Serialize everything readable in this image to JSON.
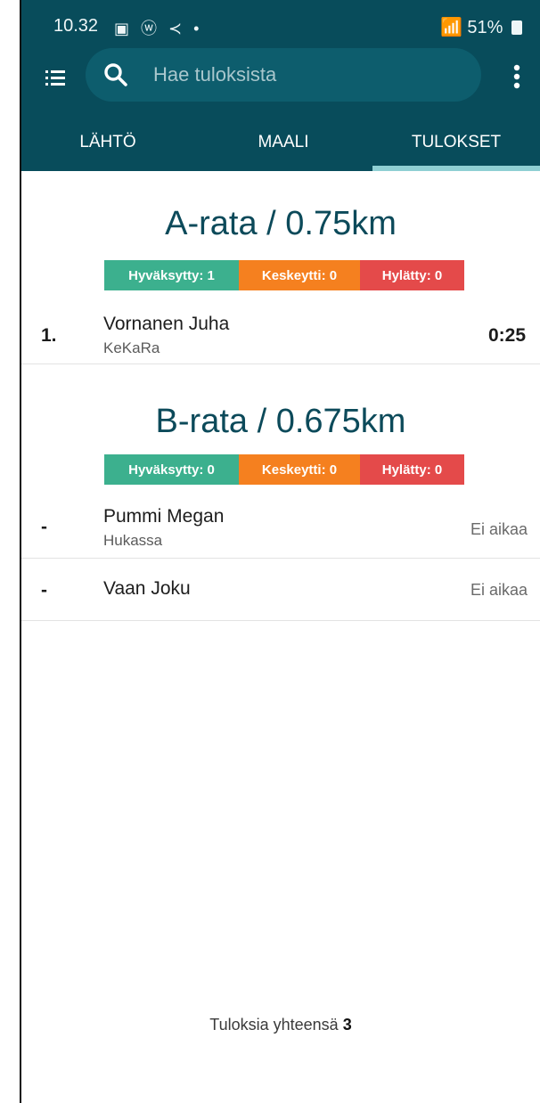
{
  "status_bar": {
    "time": "10.32",
    "icons": "▣ ⓦ ≺ •",
    "battery": "51%"
  },
  "header": {
    "search_placeholder": "Hae tuloksista"
  },
  "tabs": [
    {
      "label": "LÄHTÖ",
      "active": false
    },
    {
      "label": "MAALI",
      "active": false
    },
    {
      "label": "TULOKSET",
      "active": true
    }
  ],
  "courses": [
    {
      "title": "A-rata / 0.75km",
      "badges": {
        "approved": "Hyväksytty: 1",
        "interrupted": "Keskeytti: 0",
        "rejected": "Hylätty: 0"
      },
      "results": [
        {
          "rank": "1.",
          "name": "Vornanen Juha",
          "club": "KeKaRa",
          "time": "0:25"
        }
      ]
    },
    {
      "title": "B-rata / 0.675km",
      "badges": {
        "approved": "Hyväksytty: 0",
        "interrupted": "Keskeytti: 0",
        "rejected": "Hylätty: 0"
      },
      "results": [
        {
          "rank": "-",
          "name": "Pummi Megan",
          "club": "Hukassa",
          "time": "Ei aikaa"
        },
        {
          "rank": "-",
          "name": "Vaan Joku",
          "club": "",
          "time": "Ei aikaa"
        }
      ]
    }
  ],
  "footer": {
    "label": "Tuloksia yhteensä",
    "count": "3"
  },
  "colors": {
    "appbar": "#084c5b",
    "approved": "#3cb08e",
    "interrupted": "#f5801f",
    "rejected": "#e44a4a",
    "tab_indicator": "#8fcfd3"
  }
}
